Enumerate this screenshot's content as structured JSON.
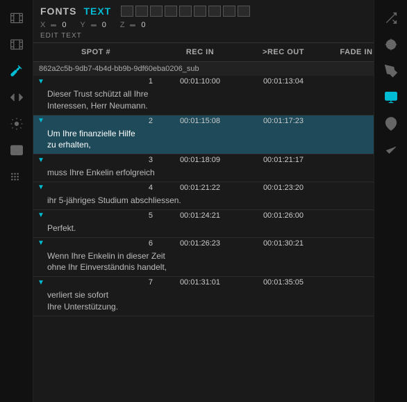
{
  "sidebar_left": {
    "items": [
      {
        "name": "film-icon",
        "label": "Film",
        "active": false
      },
      {
        "name": "film2-icon",
        "label": "Film2",
        "active": false
      },
      {
        "name": "tools-icon",
        "label": "Tools",
        "active": false
      },
      {
        "name": "code-icon",
        "label": "Code",
        "active": false
      },
      {
        "name": "settings-icon",
        "label": "Settings",
        "active": false
      },
      {
        "name": "terminal-icon",
        "label": "Terminal",
        "active": false
      },
      {
        "name": "dots-icon",
        "label": "Dots",
        "active": false
      }
    ]
  },
  "sidebar_right": {
    "items": [
      {
        "name": "shuffle-icon",
        "label": "Shuffle",
        "active": false
      },
      {
        "name": "effects-icon",
        "label": "Effects",
        "active": false
      },
      {
        "name": "pen-icon",
        "label": "Pen",
        "active": false
      },
      {
        "name": "monitor-icon",
        "label": "Monitor",
        "active": true
      },
      {
        "name": "location-icon",
        "label": "Location",
        "active": false
      },
      {
        "name": "check-icon",
        "label": "Check",
        "active": false
      }
    ]
  },
  "toolbar": {
    "fonts_label": "FONTS",
    "text_label": "TEXT",
    "font_boxes": [
      "",
      "",
      "",
      "",
      "",
      "",
      "",
      "",
      ""
    ],
    "x_label": "X",
    "x_value": "0",
    "y_label": "Y",
    "y_value": "0",
    "z_label": "Z",
    "z_value": "0",
    "edit_text_label": "EDIT TEXT"
  },
  "table": {
    "headers": [
      "SPOT #",
      "REC IN",
      ">REC OUT",
      "FADE IN"
    ],
    "file_name": "862a2c5b-9db7-4b4d-bb9b-9df60eba0206_sub",
    "rows": [
      {
        "spot": "1",
        "rec_in": "00:01:10:00",
        "rec_out": "00:01:13:04",
        "fade_in": "",
        "text": "Dieser Trust schützt all Ihre\nInteressen, Herr Neumann.",
        "selected": false
      },
      {
        "spot": "2",
        "rec_in": "00:01:15:08",
        "rec_out": "00:01:17:23",
        "fade_in": "",
        "text": "Um Ihre finanzielle Hilfe\nzu erhalten,",
        "selected": true
      },
      {
        "spot": "3",
        "rec_in": "00:01:18:09",
        "rec_out": "00:01:21:17",
        "fade_in": "",
        "text": "muss Ihre Enkelin erfolgreich",
        "selected": false
      },
      {
        "spot": "4",
        "rec_in": "00:01:21:22",
        "rec_out": "00:01:23:20",
        "fade_in": "",
        "text": "ihr 5-jähriges Studium abschliessen.",
        "selected": false
      },
      {
        "spot": "5",
        "rec_in": "00:01:24:21",
        "rec_out": "00:01:26:00",
        "fade_in": "",
        "text": "Perfekt.",
        "selected": false
      },
      {
        "spot": "6",
        "rec_in": "00:01:26:23",
        "rec_out": "00:01:30:21",
        "fade_in": "",
        "text": "Wenn Ihre Enkelin in dieser Zeit\nohne Ihr Einverständnis handelt,",
        "selected": false
      },
      {
        "spot": "7",
        "rec_in": "00:01:31:01",
        "rec_out": "00:01:35:05",
        "fade_in": "",
        "text": "verliert sie sofort\nIhre Unterstützung.",
        "selected": false
      }
    ]
  },
  "fade_in_header": "FADE IN"
}
